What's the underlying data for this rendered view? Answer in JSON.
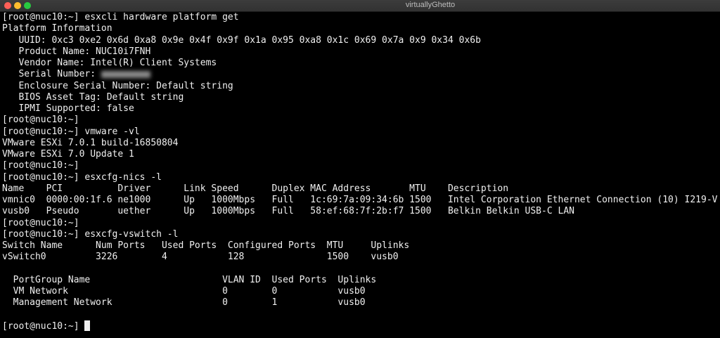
{
  "window": {
    "title": "virtuallyGhetto"
  },
  "lines": [
    "[root@nuc10:~] esxcli hardware platform get",
    "Platform Information",
    "   UUID: 0xc3 0xe2 0x6d 0xa8 0x9e 0x4f 0x9f 0x1a 0x95 0xa8 0x1c 0x69 0x7a 0x9 0x34 0x6b",
    "   Product Name: NUC10i7FNH",
    "   Vendor Name: Intel(R) Client Systems",
    "   Serial Number: ",
    "   Enclosure Serial Number: Default string",
    "   BIOS Asset Tag: Default string",
    "   IPMI Supported: false",
    "[root@nuc10:~]",
    "[root@nuc10:~] vmware -vl",
    "VMware ESXi 7.0.1 build-16850804",
    "VMware ESXi 7.0 Update 1",
    "[root@nuc10:~]",
    "[root@nuc10:~] esxcfg-nics -l",
    "Name    PCI          Driver      Link Speed      Duplex MAC Address       MTU    Description",
    "vmnic0  0000:00:1f.6 ne1000      Up   1000Mbps   Full   1c:69:7a:09:34:6b 1500   Intel Corporation Ethernet Connection (10) I219-V",
    "vusb0   Pseudo       uether      Up   1000Mbps   Full   58:ef:68:7f:2b:f7 1500   Belkin Belkin USB-C LAN",
    "[root@nuc10:~]",
    "[root@nuc10:~] esxcfg-vswitch -l",
    "Switch Name      Num Ports   Used Ports  Configured Ports  MTU     Uplinks",
    "vSwitch0         3226        4           128               1500    vusb0",
    "",
    "  PortGroup Name                        VLAN ID  Used Ports  Uplinks",
    "  VM Network                            0        0           vusb0",
    "  Management Network                    0        1           vusb0",
    "",
    "[root@nuc10:~] "
  ]
}
